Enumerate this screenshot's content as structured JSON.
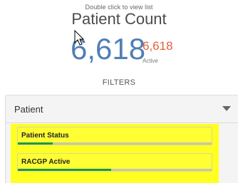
{
  "header": {
    "hint": "Double click to view list",
    "title": "Patient Count"
  },
  "counts": {
    "total": "6,618",
    "active": "6,618",
    "active_label": "Active"
  },
  "filters": {
    "heading": "FILTERS",
    "panel_title": "Patient",
    "items": [
      {
        "label": "Patient Status",
        "progress": 0.18
      },
      {
        "label": "RACGP Active",
        "progress": 0.48
      }
    ]
  },
  "colors": {
    "total": "#4f7fb5",
    "active": "#e2603b",
    "highlight": "#ffff22",
    "progress": "#1e9a3a"
  }
}
